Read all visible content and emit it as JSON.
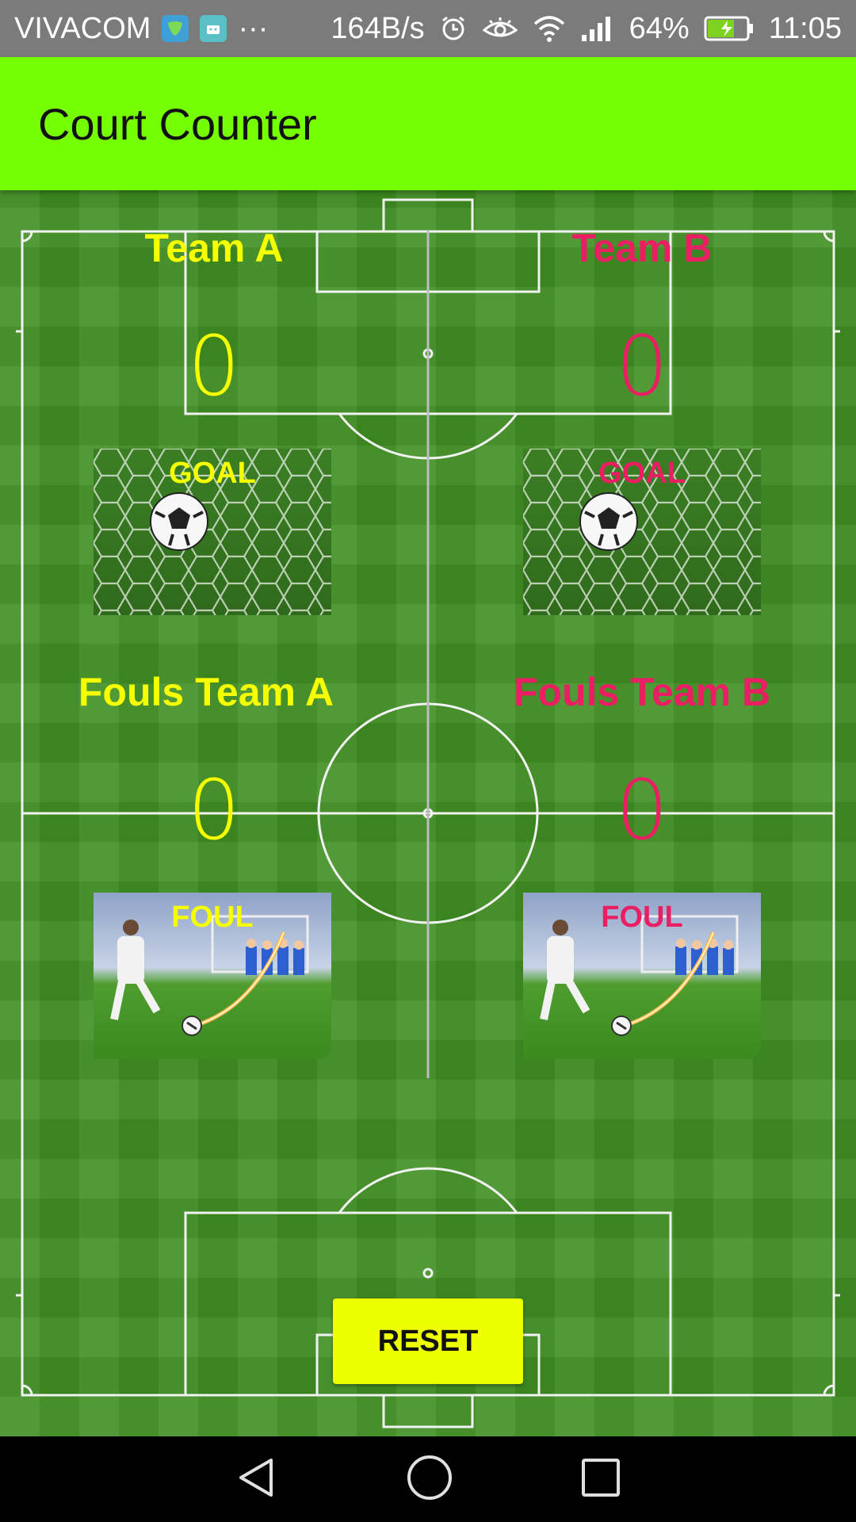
{
  "status_bar": {
    "carrier": "VIVACOM",
    "more": "···",
    "net_speed": "164B/s",
    "battery": "64%",
    "time": "11:05",
    "icons": [
      "app-icon-vpn",
      "android-debug-icon",
      "alarm-icon",
      "eye-icon",
      "wifi-icon",
      "signal-icon",
      "battery-charging-icon"
    ]
  },
  "app_bar": {
    "title": "Court Counter"
  },
  "team_a": {
    "name": "Team A",
    "score": "0",
    "goal_label": "GOAL",
    "fouls_title": "Fouls Team A",
    "fouls": "0",
    "foul_label": "FOUL",
    "color": "#f5ff00"
  },
  "team_b": {
    "name": "Team B",
    "score": "0",
    "goal_label": "GOAL",
    "fouls_title": "Fouls Team B",
    "fouls": "0",
    "foul_label": "FOUL",
    "color": "#e91e63"
  },
  "reset": {
    "label": "RESET",
    "color": "#eeff00"
  },
  "nav": {
    "icons": [
      "back-icon",
      "home-icon",
      "recents-icon"
    ]
  },
  "colors": {
    "app_bar": "#76ff03",
    "field": "#3f8f22",
    "status_bar": "#7b7b7b"
  }
}
